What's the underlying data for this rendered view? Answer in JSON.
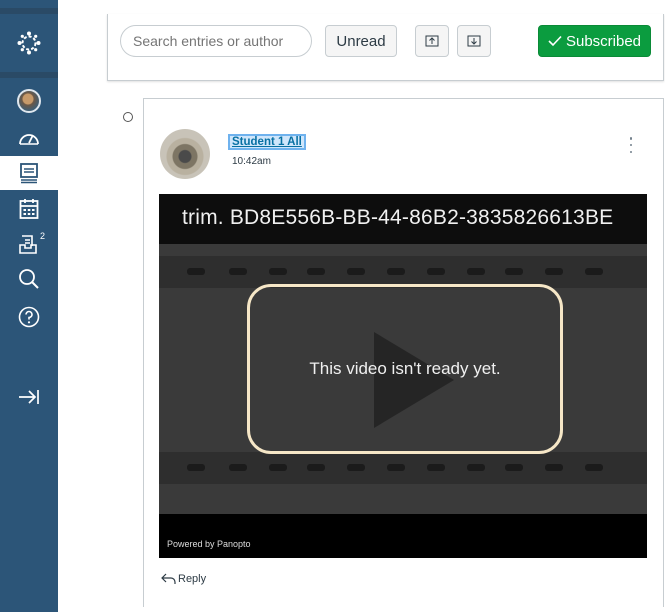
{
  "toolbar": {
    "search_placeholder": "Search entries or author",
    "unread_label": "Unread",
    "subscribed_label": "Subscribed"
  },
  "nav": {
    "icons": [
      "canvas-logo-icon",
      "account-avatar-icon",
      "dashboard-icon",
      "courses-icon",
      "calendar-icon",
      "inbox-icon",
      "search-icon",
      "help-icon",
      "collapse-nav-icon"
    ],
    "inbox_badge": "2"
  },
  "entry": {
    "author": "Student 1 All",
    "timestamp": "10:42am",
    "video": {
      "title": "trim. BD8E556B-BB-44-86B2-3835826613BE",
      "message": "This video isn't ready yet.",
      "footer": "Powered by Panopto"
    },
    "reply_label": "Reply"
  },
  "colors": {
    "nav_bg": "#2c5578",
    "subscribed_green": "#0b9c3f",
    "link_blue": "#0770a3"
  }
}
